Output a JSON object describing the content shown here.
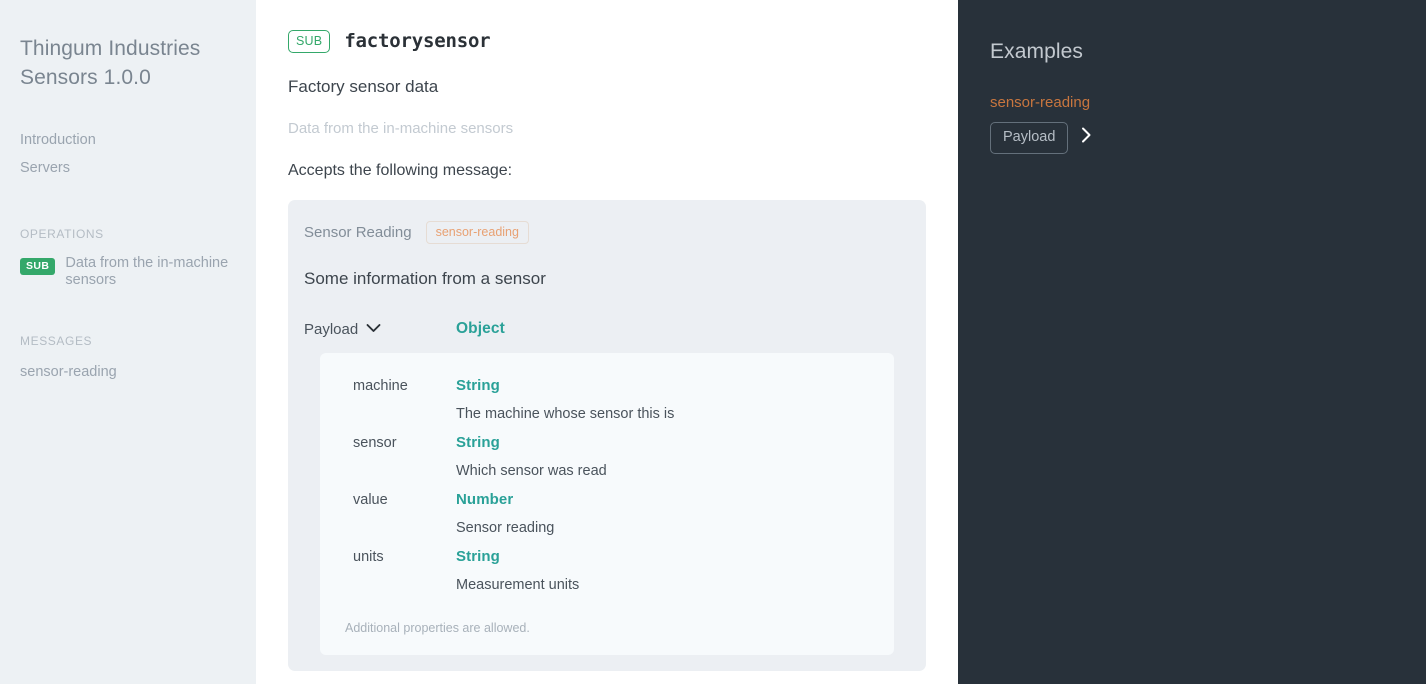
{
  "sidebar": {
    "brand_title": "Thingum Industries Sensors 1.0.0",
    "links": [
      {
        "label": "Introduction"
      },
      {
        "label": "Servers"
      }
    ],
    "operations_heading": "OPERATIONS",
    "operations": [
      {
        "badge": "SUB",
        "label": "Data from the in-machine sensors"
      }
    ],
    "messages_heading": "MESSAGES",
    "messages": [
      {
        "label": "sensor-reading"
      }
    ]
  },
  "main": {
    "operation": {
      "badge": "SUB",
      "channel": "factorysensor",
      "summary": "Factory sensor data",
      "description": "Data from the in-machine sensors",
      "accepts_label": "Accepts the following message:"
    },
    "message": {
      "name": "Sensor Reading",
      "message_id": "sensor-reading",
      "title": "Some information from a sensor",
      "payload_label": "Payload",
      "payload_type": "Object",
      "properties": [
        {
          "key": "machine",
          "type": "String",
          "description": "The machine whose sensor this is"
        },
        {
          "key": "sensor",
          "type": "String",
          "description": "Which sensor was read"
        },
        {
          "key": "value",
          "type": "Number",
          "description": "Sensor reading"
        },
        {
          "key": "units",
          "type": "String",
          "description": "Measurement units"
        }
      ],
      "additional_note": "Additional properties are allowed."
    }
  },
  "right_panel": {
    "title": "Examples",
    "example_name": "sensor-reading",
    "tab_label": "Payload"
  },
  "colors": {
    "sidebar_bg": "#edf1f4",
    "panel_bg": "#28313a",
    "sub_green": "#34a86a",
    "type_teal": "#2aa198",
    "message_id_orange": "#e8a173",
    "example_orange": "#c8763f",
    "card_bg": "#eceff3",
    "table_bg": "#f7fafc"
  }
}
